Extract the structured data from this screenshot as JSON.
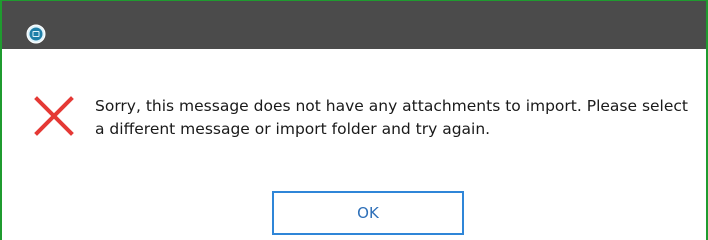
{
  "colors": {
    "titlebar": "#4b4b4b",
    "window_border": "#1f9b2f",
    "error_x": "#e53935",
    "button_border": "#2f86d8",
    "button_text": "#2d6fb8"
  },
  "window": {
    "app_icon": "app-logo-icon"
  },
  "dialog": {
    "icon": "error-x-icon",
    "message_line1": "Sorry, this message does not have any attachments to import. Please select",
    "message_line2": "a different message or import folder and try again.",
    "ok_label": "OK"
  }
}
